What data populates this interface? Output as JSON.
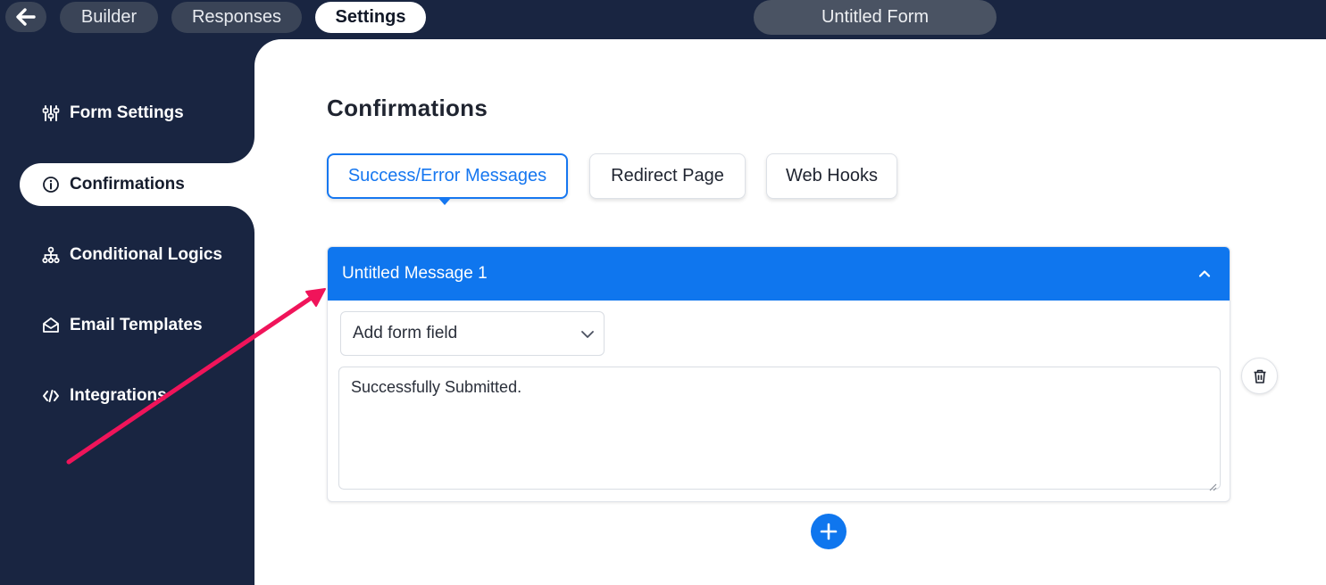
{
  "topbar": {
    "back_icon": "arrow-left-icon",
    "tabs": [
      "Builder",
      "Responses",
      "Settings"
    ],
    "active_tab": "Settings",
    "form_title": "Untitled Form"
  },
  "sidebar": {
    "items": [
      {
        "label": "Form Settings",
        "icon": "sliders-icon"
      },
      {
        "label": "Confirmations",
        "icon": "info-circle-icon"
      },
      {
        "label": "Conditional Logics",
        "icon": "hierarchy-icon"
      },
      {
        "label": "Email Templates",
        "icon": "envelope-open-icon"
      },
      {
        "label": "Integrations",
        "icon": "code-icon"
      }
    ],
    "active_item": "Confirmations"
  },
  "main": {
    "title": "Confirmations",
    "tabs": [
      "Success/Error Messages",
      "Redirect Page",
      "Web Hooks"
    ],
    "active_tab": "Success/Error Messages",
    "message_card": {
      "title": "Untitled Message 1",
      "field_select_placeholder": "Add form field",
      "message_text": "Successfully Submitted."
    }
  },
  "colors": {
    "sidebar_bg": "#192541",
    "accent": "#0f76ee",
    "annotation_arrow": "#f0145a"
  }
}
